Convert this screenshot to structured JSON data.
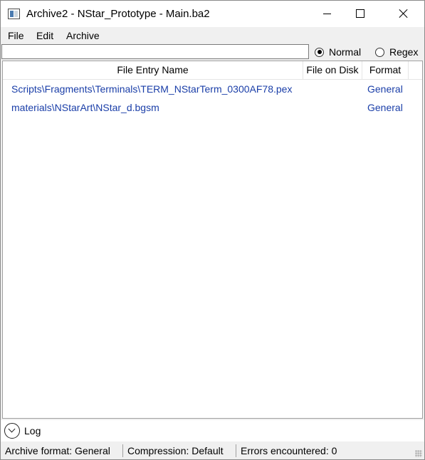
{
  "window": {
    "title": "Archive2 - NStar_Prototype - Main.ba2"
  },
  "menu": {
    "file": "File",
    "edit": "Edit",
    "archive": "Archive"
  },
  "search": {
    "value": "",
    "placeholder": ""
  },
  "filter_mode": {
    "normal_label": "Normal",
    "regex_label": "Regex",
    "selected": "Normal"
  },
  "list": {
    "columns": {
      "name": "File Entry Name",
      "disk": "File on Disk",
      "format": "Format"
    },
    "rows": [
      {
        "name": "Scripts\\Fragments\\Terminals\\TERM_NStarTerm_0300AF78.pex",
        "disk": "",
        "format": "General"
      },
      {
        "name": "materials\\NStarArt\\NStar_d.bgsm",
        "disk": "",
        "format": "General"
      }
    ]
  },
  "log": {
    "label": "Log"
  },
  "status": {
    "format": "Archive format:  General",
    "compression": "Compression:  Default",
    "errors": "Errors encountered:  0"
  },
  "colors": {
    "row_text": "#1a3ea8",
    "chrome_bg": "#f0f0f0"
  }
}
